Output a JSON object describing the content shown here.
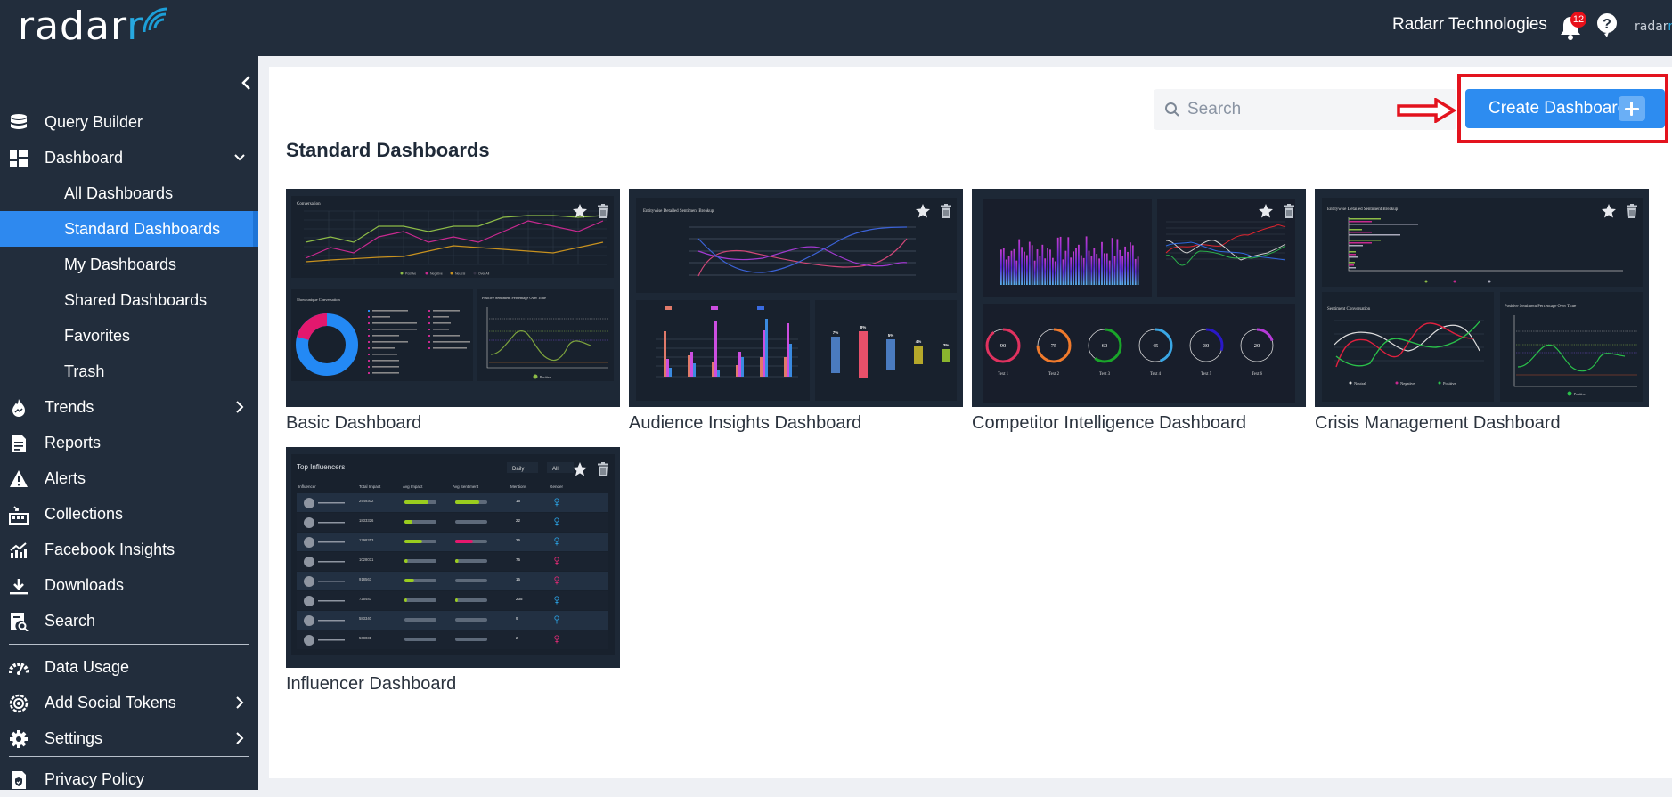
{
  "header": {
    "logo_text": "radar",
    "logo_text_accent": "r",
    "organization": "Radarr Technologies",
    "notification_count": "12",
    "brand_small": "radar",
    "brand_small_accent": "r"
  },
  "sidebar": {
    "items": [
      {
        "label": "Query Builder",
        "icon": "database-icon"
      },
      {
        "label": "Dashboard",
        "icon": "dashboard-icon",
        "expanded": true
      },
      {
        "label": "All Dashboards"
      },
      {
        "label": "Standard Dashboards",
        "active": true
      },
      {
        "label": "My Dashboards"
      },
      {
        "label": "Shared Dashboards"
      },
      {
        "label": "Favorites"
      },
      {
        "label": "Trash"
      },
      {
        "label": "Trends",
        "icon": "flame-icon"
      },
      {
        "label": "Reports",
        "icon": "report-icon"
      },
      {
        "label": "Alerts",
        "icon": "warning-icon"
      },
      {
        "label": "Collections",
        "icon": "collections-icon"
      },
      {
        "label": "Facebook Insights",
        "icon": "insights-chart-icon"
      },
      {
        "label": "Downloads",
        "icon": "download-icon"
      },
      {
        "label": "Search",
        "icon": "search-document-icon"
      },
      {
        "label": "Data Usage",
        "icon": "speedometer-icon"
      },
      {
        "label": "Add Social Tokens",
        "icon": "token-icon"
      },
      {
        "label": "Settings",
        "icon": "gear-icon"
      },
      {
        "label": "Privacy Policy",
        "icon": "privacy-shield-icon"
      }
    ]
  },
  "toolbar": {
    "search_placeholder": "Search",
    "search_value": "",
    "create_label": "Create Dashboard"
  },
  "main": {
    "title": "Standard Dashboards",
    "dashboards": [
      {
        "name": "Basic Dashboard",
        "preview": {
          "chart1_title": "Conversation",
          "legend": [
            "Positive",
            "Negative",
            "Neutral",
            "Over All"
          ],
          "chart2_title": "Show unique Conversation",
          "chart3_title": "Positive Sentiment Percentage Over Time",
          "chart3_legend": "Positive"
        }
      },
      {
        "name": "Audience Insights Dashboard",
        "preview": {
          "chart1_title": "Entitywise Detailed Sentiment Breakup",
          "funnel_labels": [
            "7%",
            "8%",
            "5%",
            "4%",
            "3%"
          ]
        }
      },
      {
        "name": "Competitor Intelligence Dashboard",
        "preview": {
          "gauges": [
            {
              "value": "90",
              "label": "Text 1",
              "color": "#e0325f"
            },
            {
              "value": "75",
              "label": "Text 2",
              "color": "#f07a2c"
            },
            {
              "value": "60",
              "label": "Text 3",
              "color": "#1aa52a"
            },
            {
              "value": "45",
              "label": "Text 4",
              "color": "#3aa7e5"
            },
            {
              "value": "30",
              "label": "Text 5",
              "color": "#2a18c8"
            },
            {
              "value": "20",
              "label": "Text 6",
              "color": "#b63ad8"
            }
          ]
        }
      },
      {
        "name": "Crisis Management Dashboard",
        "preview": {
          "chart1_title": "Entitywise Detailed Sentiment Breakup",
          "chart2_title": "Sentiment Conversation",
          "chart2_legend": [
            "Neutral",
            "Negative",
            "Positive"
          ],
          "chart3_title": "Positive Sentiment Percentage Over Time",
          "chart3_legend": "Positive"
        }
      },
      {
        "name": "Influencer Dashboard",
        "preview": {
          "title": "Top Influencers",
          "filter_period": "Daily",
          "filter_scope": "All",
          "columns": [
            "Influencer",
            "Total Impact",
            "Avg Impact",
            "Avg Sentiment",
            "Mentions",
            "Gender"
          ],
          "rows": [
            {
              "impact": "2949302",
              "mentions": "15"
            },
            {
              "impact": "1833326",
              "mentions": "22"
            },
            {
              "impact": "1398313",
              "mentions": "26"
            },
            {
              "impact": "1028031",
              "mentions": "75"
            },
            {
              "impact": "918563",
              "mentions": "15"
            },
            {
              "impact": "725483",
              "mentions": "235"
            },
            {
              "impact": "583340",
              "mentions": "9"
            },
            {
              "impact": "568031",
              "mentions": "2"
            }
          ]
        }
      }
    ]
  }
}
